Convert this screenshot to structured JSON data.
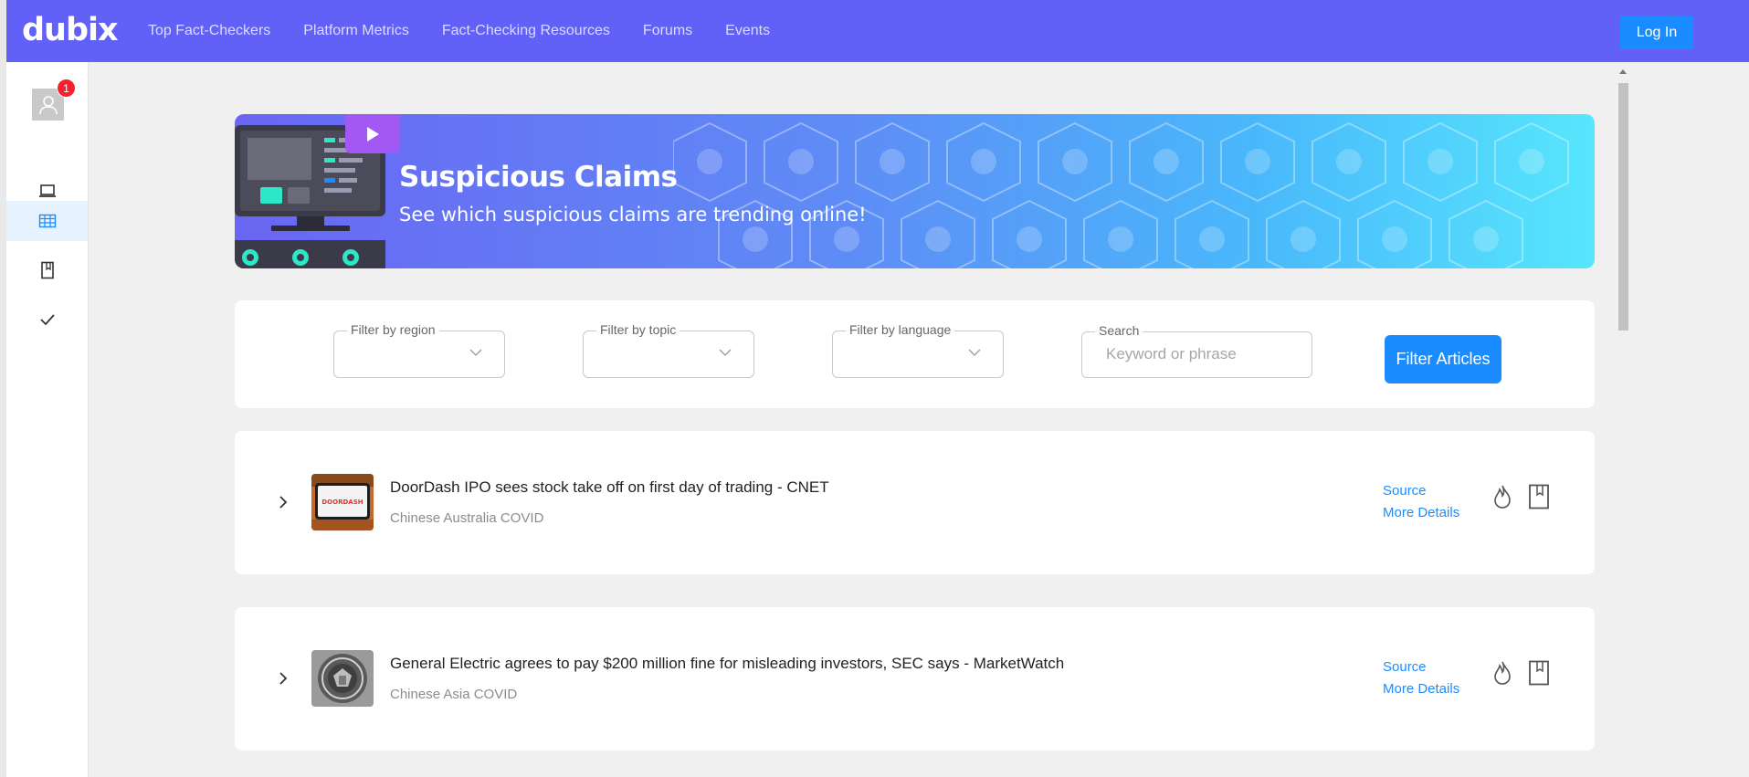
{
  "app": {
    "logo": "dubix"
  },
  "nav": {
    "links": [
      "Top Fact-Checkers",
      "Platform Metrics",
      "Fact-Checking Resources",
      "Forums",
      "Events"
    ],
    "login_label": "Log In"
  },
  "sidebar": {
    "notification_count": "1",
    "items": [
      {
        "icon": "laptop-icon",
        "active": false
      },
      {
        "icon": "table-icon",
        "active": true
      },
      {
        "icon": "bookmark-icon",
        "active": false
      },
      {
        "icon": "check-icon",
        "active": false
      }
    ]
  },
  "banner": {
    "title": "Suspicious Claims",
    "subtitle": "See which suspicious claims are trending online!"
  },
  "filters": {
    "region_label": "Filter by region",
    "topic_label": "Filter by topic",
    "language_label": "Filter by language",
    "search_label": "Search",
    "search_placeholder": "Keyword or phrase",
    "button_label": "Filter Articles"
  },
  "articles": [
    {
      "title": "DoorDash IPO sees stock take off on first day of trading - CNET",
      "tags": "Chinese Australia COVID",
      "source_label": "Source",
      "details_label": "More Details"
    },
    {
      "title": "General Electric agrees to pay $200 million fine for misleading investors, SEC says - MarketWatch",
      "tags": "Chinese Asia COVID",
      "source_label": "Source",
      "details_label": "More Details"
    }
  ],
  "colors": {
    "nav_bg": "#6161f7",
    "accent": "#1b8cff",
    "badge": "#f5222d",
    "sidebar_active_bg": "#e6f3ff"
  }
}
